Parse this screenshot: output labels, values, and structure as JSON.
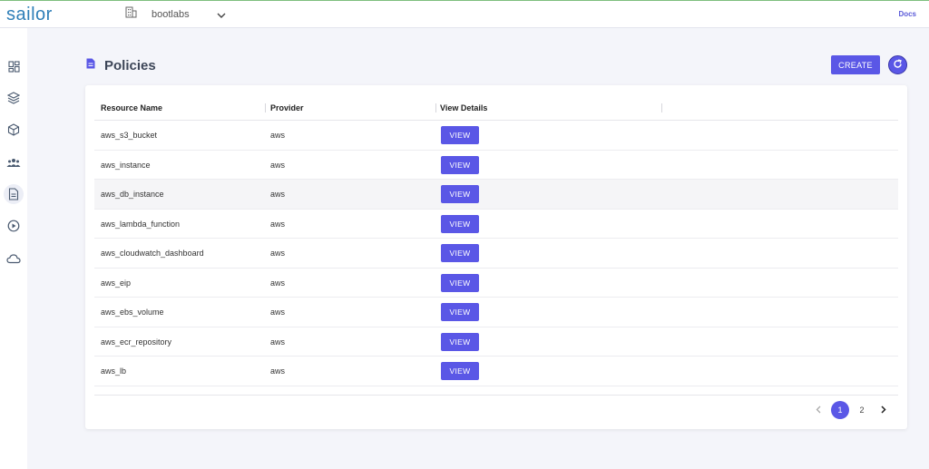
{
  "app": {
    "logo": "sailor",
    "docs_label": "Docs"
  },
  "org": {
    "name": "bootlabs"
  },
  "page": {
    "title": "Policies",
    "create_label": "CREATE"
  },
  "table": {
    "headers": [
      "Resource Name",
      "Provider",
      "View Details"
    ],
    "view_label": "VIEW",
    "rows": [
      {
        "resource": "aws_s3_bucket",
        "provider": "aws"
      },
      {
        "resource": "aws_instance",
        "provider": "aws"
      },
      {
        "resource": "aws_db_instance",
        "provider": "aws"
      },
      {
        "resource": "aws_lambda_function",
        "provider": "aws"
      },
      {
        "resource": "aws_cloudwatch_dashboard",
        "provider": "aws"
      },
      {
        "resource": "aws_eip",
        "provider": "aws"
      },
      {
        "resource": "aws_ebs_volume",
        "provider": "aws"
      },
      {
        "resource": "aws_ecr_repository",
        "provider": "aws"
      },
      {
        "resource": "aws_lb",
        "provider": "aws"
      }
    ]
  },
  "pagination": {
    "pages": [
      "1",
      "2"
    ],
    "current": "1"
  },
  "colors": {
    "accent": "#5a57e6",
    "logo": "#2f7fb8"
  }
}
